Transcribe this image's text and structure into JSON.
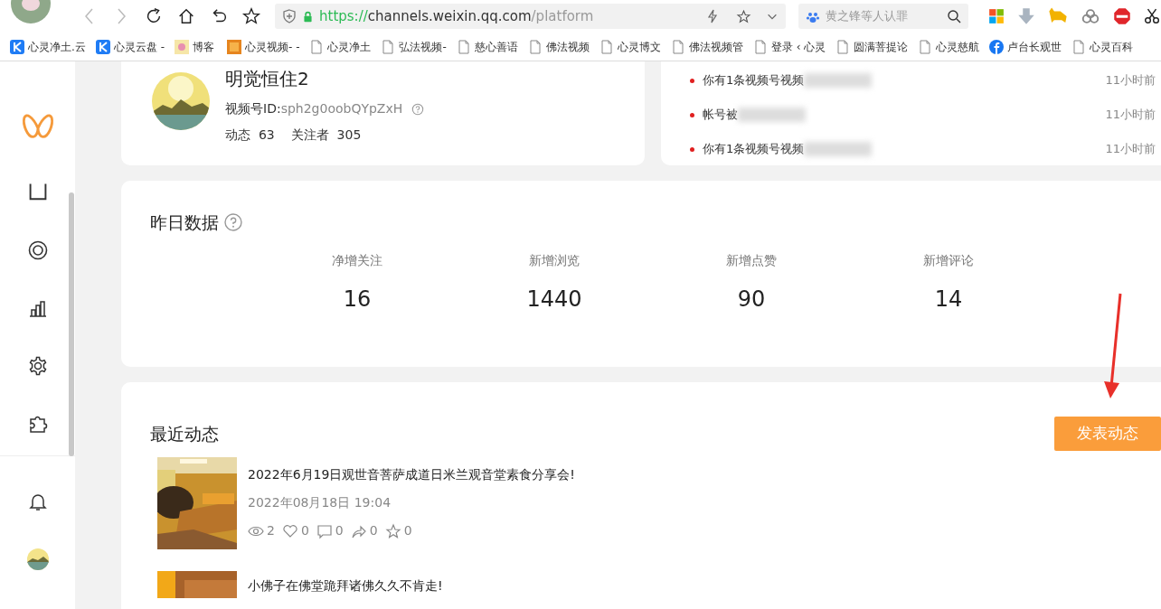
{
  "browser": {
    "url_scheme": "https://",
    "url_host": "channels.weixin.qq.com",
    "url_path": "/platform",
    "search_placeholder": "黄之锋等人认罪"
  },
  "bookmarks": [
    {
      "kind": "k",
      "label": "心灵净土.云"
    },
    {
      "kind": "k",
      "label": "心灵云盘 -"
    },
    {
      "kind": "flower",
      "label": "博客"
    },
    {
      "kind": "orange",
      "label": "心灵视频- -"
    },
    {
      "kind": "page",
      "label": "心灵净土"
    },
    {
      "kind": "page",
      "label": "弘法视频-"
    },
    {
      "kind": "page",
      "label": "慈心善语"
    },
    {
      "kind": "page",
      "label": "佛法视频"
    },
    {
      "kind": "page",
      "label": "心灵博文"
    },
    {
      "kind": "page",
      "label": "佛法视频管"
    },
    {
      "kind": "page",
      "label": "登录 ‹ 心灵"
    },
    {
      "kind": "page",
      "label": "圆满菩提论"
    },
    {
      "kind": "page",
      "label": "心灵慈航"
    },
    {
      "kind": "facebook",
      "label": "卢台长观世"
    },
    {
      "kind": "page",
      "label": "心灵百科"
    }
  ],
  "profile": {
    "name": "明觉恒住2",
    "id_label": "视频号ID:",
    "id_value": "sph2g0oobQYpZxH",
    "posts_label": "动态",
    "posts": "63",
    "followers_label": "关注者",
    "followers": "305"
  },
  "notifications": [
    {
      "text": "你有1条视频号视频",
      "time": "11小时前",
      "blurred": true
    },
    {
      "text": "帐号被",
      "time": "11小时前",
      "blurred": true
    },
    {
      "text": "你有1条视频号视频",
      "time": "11小时前",
      "blurred": true
    }
  ],
  "yesterday": {
    "title": "昨日数据",
    "stats": [
      {
        "label": "净增关注",
        "value": "16"
      },
      {
        "label": "新增浏览",
        "value": "1440"
      },
      {
        "label": "新增点赞",
        "value": "90"
      },
      {
        "label": "新增评论",
        "value": "14"
      }
    ]
  },
  "recent": {
    "title": "最近动态",
    "button": "发表动态",
    "posts": [
      {
        "title": "2022年6月19日观世音菩萨成道日米兰观音堂素食分享会!",
        "date": "2022年08月18日 19:04",
        "counts": [
          {
            "value": "2"
          },
          {
            "value": "0"
          },
          {
            "value": "0"
          },
          {
            "value": "0"
          },
          {
            "value": "0"
          }
        ]
      },
      {
        "title": "小佛子在佛堂跪拜诸佛久久不肯走!"
      }
    ]
  }
}
